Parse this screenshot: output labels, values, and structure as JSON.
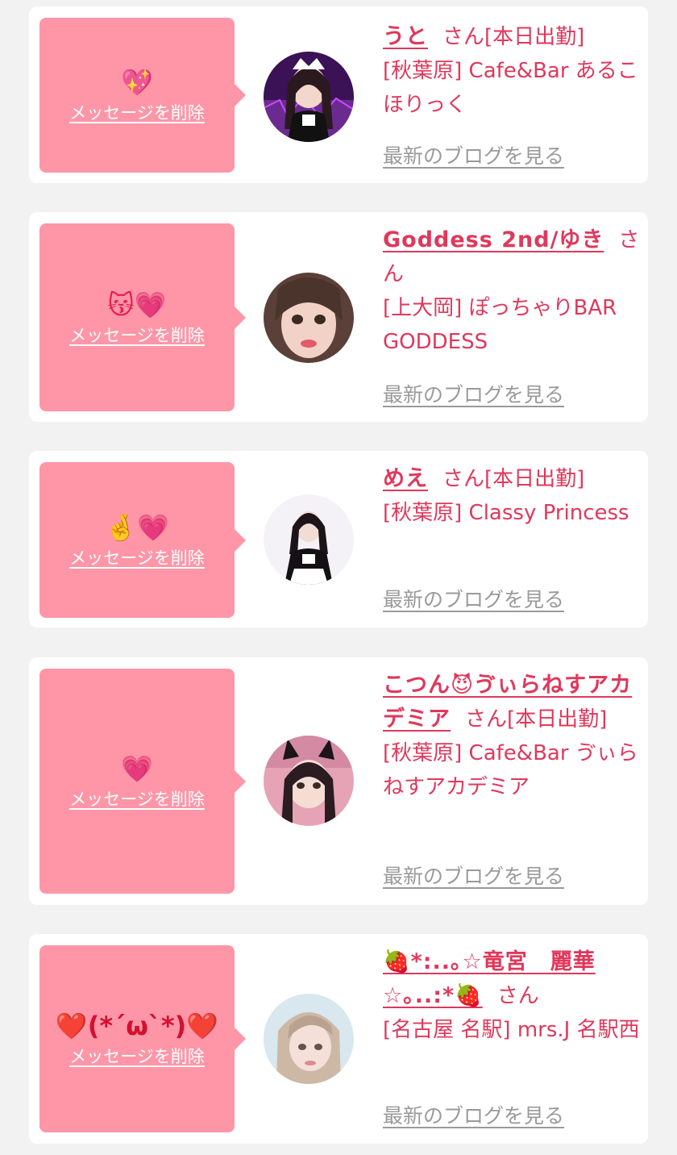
{
  "delete_label": "メッセージを削除",
  "blog_label": "最新のブログを見る",
  "san": "さん",
  "colors": {
    "accent": "#e0385b",
    "box": "#ff96a8",
    "background": "#f2f2f2"
  },
  "cards": [
    {
      "emoji": "💖",
      "name": "うと",
      "status": "[本日出勤]",
      "shop": "[秋葉原] Cafe&Bar あるこほりっく",
      "avatar_icon": "maid-portrait-purple"
    },
    {
      "emoji": "😽💗",
      "name": "Goddess 2nd/ゆき",
      "status": "",
      "shop": "[上大岡] ぽっちゃりBAR GODDESS",
      "avatar_icon": "face-portrait"
    },
    {
      "emoji": "🤞💗",
      "name": "めえ",
      "status": "[本日出勤]",
      "shop": "[秋葉原] Classy Princess",
      "avatar_icon": "maid-portrait-white"
    },
    {
      "emoji": "💗",
      "name": "こつん😈ゔぃらねすアカデミア",
      "status": "[本日出勤]",
      "shop": "[秋葉原] Cafe&Bar ゔぃらねすアカデミア",
      "avatar_icon": "catears-portrait-pink"
    },
    {
      "emoji": "❤️(*´ω`*)❤️",
      "name": "🍓*:..｡☆竜宮　麗華☆｡..:*🍓",
      "status": "",
      "shop": "[名古屋 名駅] mrs.J 名駅西",
      "avatar_icon": "blonde-portrait"
    }
  ]
}
